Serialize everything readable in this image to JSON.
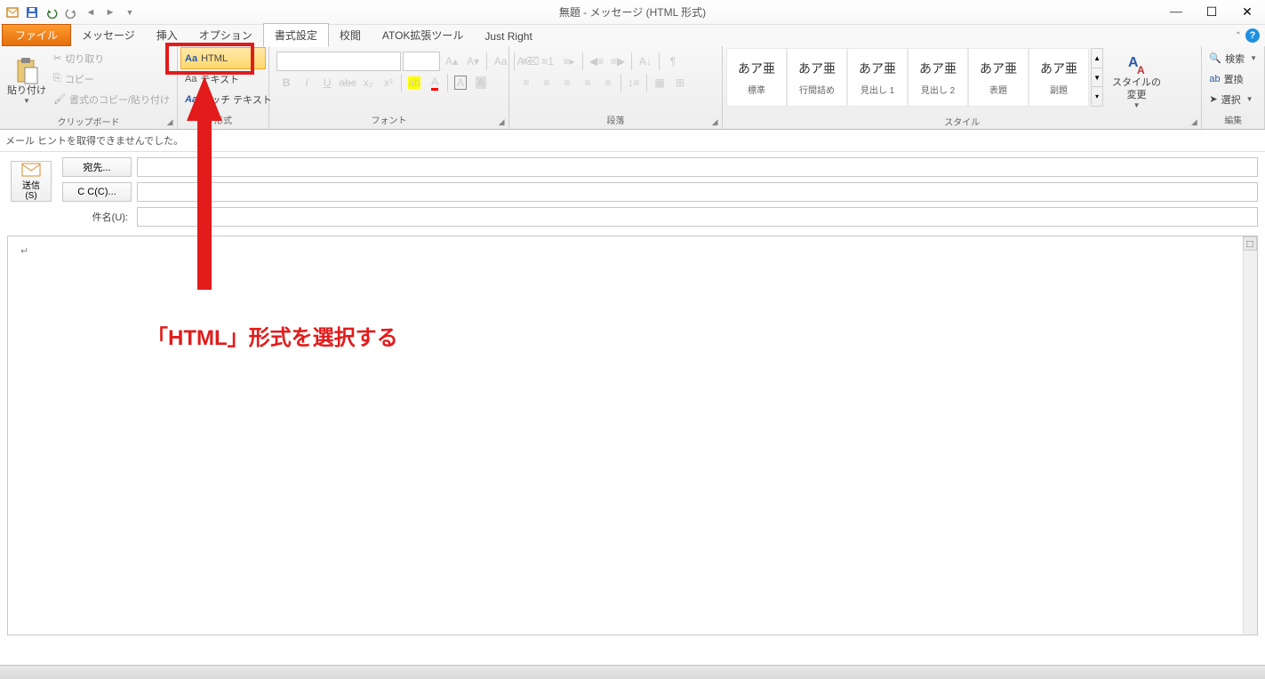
{
  "window": {
    "title": "無題 - メッセージ (HTML 形式)"
  },
  "tabs": {
    "file": "ファイル",
    "message": "メッセージ",
    "insert": "挿入",
    "options": "オプション",
    "format": "書式設定",
    "review": "校閲",
    "atok": "ATOK拡張ツール",
    "justright": "Just Right"
  },
  "ribbon": {
    "clipboard": {
      "label": "クリップボード",
      "paste": "貼り付け",
      "cut": "切り取り",
      "copy": "コピー",
      "formatpainter": "書式のコピー/貼り付け"
    },
    "format": {
      "label": "形式",
      "html": "HTML",
      "text": "テキスト",
      "rich": "リッチ テキスト",
      "aa": "Aa"
    },
    "font": {
      "label": "フォント"
    },
    "paragraph": {
      "label": "段落"
    },
    "styles": {
      "label": "スタイル",
      "sample": "あア亜",
      "items": [
        "標準",
        "行間詰め",
        "見出し 1",
        "見出し 2",
        "表題",
        "副題"
      ],
      "change": "スタイルの\n変更"
    },
    "edit": {
      "label": "編集",
      "find": "検索",
      "replace": "置換",
      "select": "選択"
    }
  },
  "hint": "メール ヒントを取得できませんでした。",
  "compose": {
    "send": "送信",
    "send_key": "(S)",
    "to": "宛先...",
    "cc": "C C(C)...",
    "subject_label": "件名(U):",
    "to_value": "",
    "cc_value": "",
    "subject_value": ""
  },
  "annotation": {
    "text": "「HTML」形式を選択する"
  }
}
